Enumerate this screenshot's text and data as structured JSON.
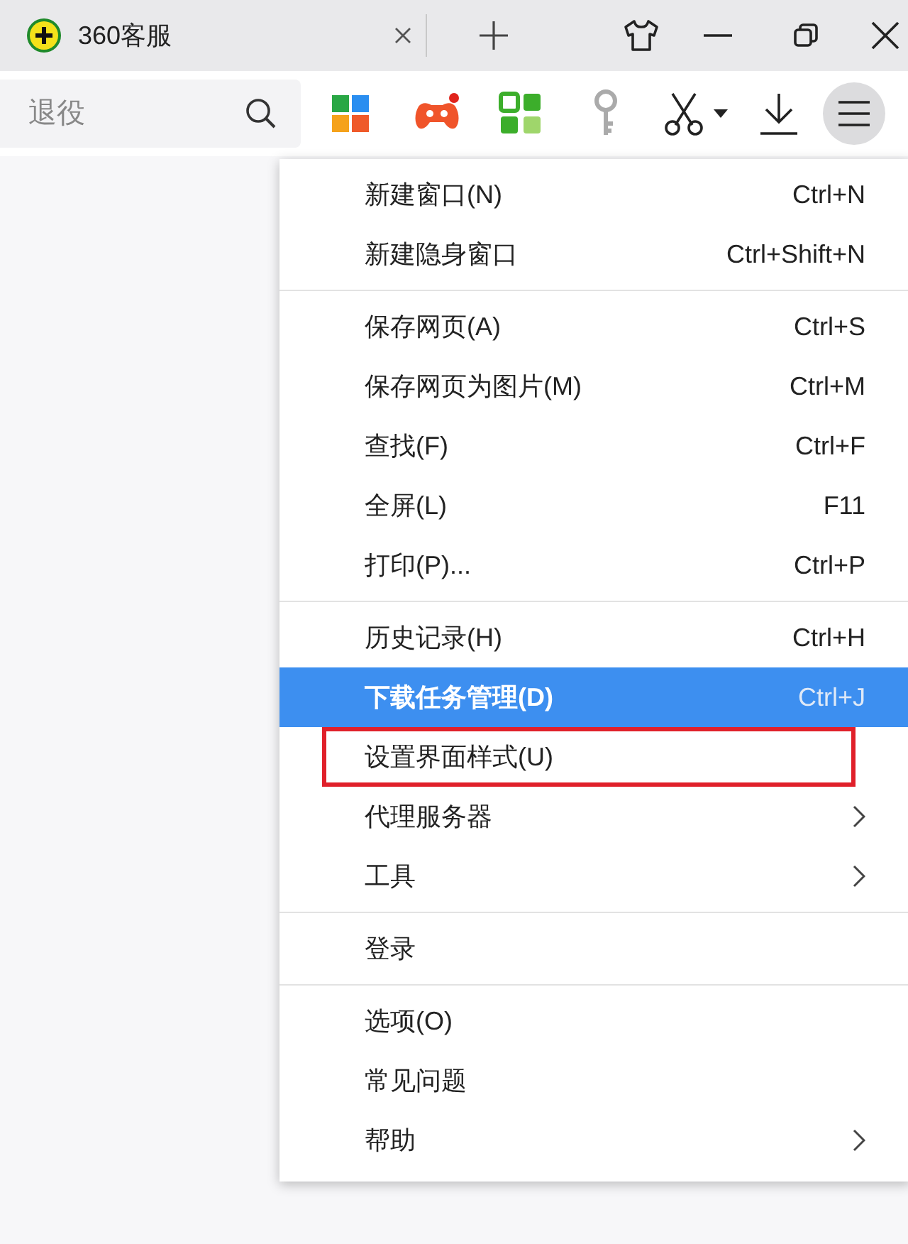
{
  "tab": {
    "title": "360客服"
  },
  "address": {
    "value": "退役"
  },
  "menu": {
    "groups": [
      {
        "items": [
          {
            "label": "新建窗口(N)",
            "shortcut": "Ctrl+N",
            "submenu": false,
            "selected": false,
            "outlined": false
          },
          {
            "label": "新建隐身窗口",
            "shortcut": "Ctrl+Shift+N",
            "submenu": false,
            "selected": false,
            "outlined": false
          }
        ]
      },
      {
        "items": [
          {
            "label": "保存网页(A)",
            "shortcut": "Ctrl+S",
            "submenu": false,
            "selected": false,
            "outlined": false
          },
          {
            "label": "保存网页为图片(M)",
            "shortcut": "Ctrl+M",
            "submenu": false,
            "selected": false,
            "outlined": false
          },
          {
            "label": "查找(F)",
            "shortcut": "Ctrl+F",
            "submenu": false,
            "selected": false,
            "outlined": false
          },
          {
            "label": "全屏(L)",
            "shortcut": "F11",
            "submenu": false,
            "selected": false,
            "outlined": false
          },
          {
            "label": "打印(P)...",
            "shortcut": "Ctrl+P",
            "submenu": false,
            "selected": false,
            "outlined": false
          }
        ]
      },
      {
        "items": [
          {
            "label": "历史记录(H)",
            "shortcut": "Ctrl+H",
            "submenu": false,
            "selected": false,
            "outlined": false
          },
          {
            "label": "下载任务管理(D)",
            "shortcut": "Ctrl+J",
            "submenu": false,
            "selected": true,
            "outlined": false
          },
          {
            "label": "设置界面样式(U)",
            "submenu": false,
            "selected": false,
            "outlined": true
          },
          {
            "label": "代理服务器",
            "submenu": true,
            "selected": false,
            "outlined": false
          },
          {
            "label": "工具",
            "submenu": true,
            "selected": false,
            "outlined": false
          }
        ]
      },
      {
        "items": [
          {
            "label": "登录",
            "submenu": false,
            "selected": false,
            "outlined": false
          }
        ]
      },
      {
        "items": [
          {
            "label": "选项(O)",
            "submenu": false,
            "selected": false,
            "outlined": false
          },
          {
            "label": "常见问题",
            "submenu": false,
            "selected": false,
            "outlined": false
          },
          {
            "label": "帮助",
            "submenu": true,
            "selected": false,
            "outlined": false
          }
        ]
      }
    ]
  }
}
